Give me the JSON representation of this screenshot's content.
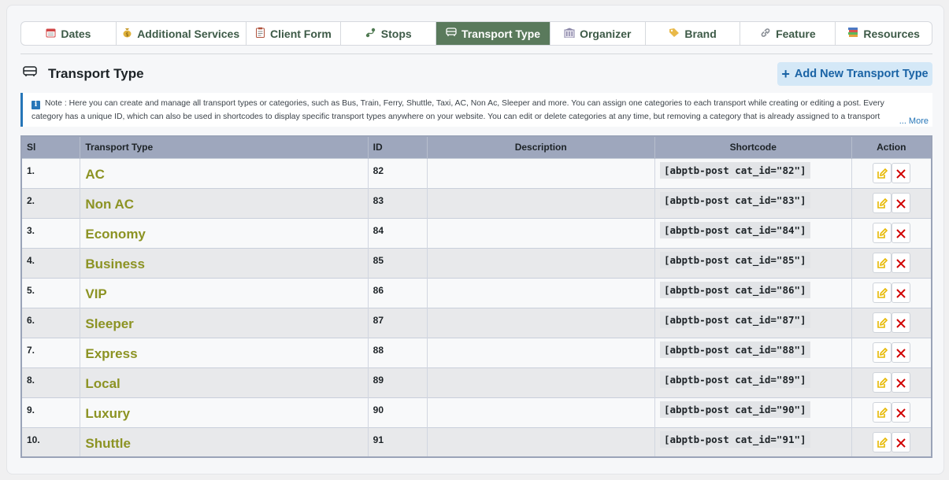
{
  "tabs": [
    {
      "label": "Dates",
      "icon": "calendar-icon"
    },
    {
      "label": "Additional Services",
      "icon": "money-bag-icon"
    },
    {
      "label": "Client Form",
      "icon": "clipboard-icon"
    },
    {
      "label": "Stops",
      "icon": "route-icon"
    },
    {
      "label": "Transport Type",
      "icon": "bus-icon",
      "active": true
    },
    {
      "label": "Organizer",
      "icon": "building-icon"
    },
    {
      "label": "Brand",
      "icon": "tag-icon"
    },
    {
      "label": "Feature",
      "icon": "link-icon"
    },
    {
      "label": "Resources",
      "icon": "books-icon"
    }
  ],
  "header": {
    "title": "Transport Type",
    "add_button": "Add New Transport Type"
  },
  "note": {
    "text": "Note : Here you can create and manage all transport types or categories, such as Bus, Train, Ferry, Shuttle, Taxi, AC, Non Ac, Sleeper and more. You can assign one categories to each transport while creating or editing a post. Every category has a unique ID, which can also be used in shortcodes to display specific transport types anywhere on your website. You can edit or delete categories at any time, but removing a category that is already assigned to a transport may affect how it is displayed.",
    "more": "... More"
  },
  "table": {
    "columns": [
      "Sl",
      "Transport Type",
      "ID",
      "Description",
      "Shortcode",
      "Action"
    ],
    "rows": [
      {
        "sl": "1.",
        "name": "AC",
        "id": "82",
        "description": "",
        "shortcode": "[abptb-post cat_id=\"82\"]"
      },
      {
        "sl": "2.",
        "name": "Non AC",
        "id": "83",
        "description": "",
        "shortcode": "[abptb-post cat_id=\"83\"]"
      },
      {
        "sl": "3.",
        "name": "Economy",
        "id": "84",
        "description": "",
        "shortcode": "[abptb-post cat_id=\"84\"]"
      },
      {
        "sl": "4.",
        "name": "Business",
        "id": "85",
        "description": "",
        "shortcode": "[abptb-post cat_id=\"85\"]"
      },
      {
        "sl": "5.",
        "name": "VIP",
        "id": "86",
        "description": "",
        "shortcode": "[abptb-post cat_id=\"86\"]"
      },
      {
        "sl": "6.",
        "name": "Sleeper",
        "id": "87",
        "description": "",
        "shortcode": "[abptb-post cat_id=\"87\"]"
      },
      {
        "sl": "7.",
        "name": "Express",
        "id": "88",
        "description": "",
        "shortcode": "[abptb-post cat_id=\"88\"]"
      },
      {
        "sl": "8.",
        "name": "Local",
        "id": "89",
        "description": "",
        "shortcode": "[abptb-post cat_id=\"89\"]"
      },
      {
        "sl": "9.",
        "name": "Luxury",
        "id": "90",
        "description": "",
        "shortcode": "[abptb-post cat_id=\"90\"]"
      },
      {
        "sl": "10.",
        "name": "Shuttle",
        "id": "91",
        "description": "",
        "shortcode": "[abptb-post cat_id=\"91\"]"
      }
    ]
  },
  "colors": {
    "active_tab": "#5a7a5c",
    "type_name": "#8c9323",
    "edit_icon": "#e6b800",
    "delete_icon": "#d10000",
    "accent": "#2676b8"
  }
}
